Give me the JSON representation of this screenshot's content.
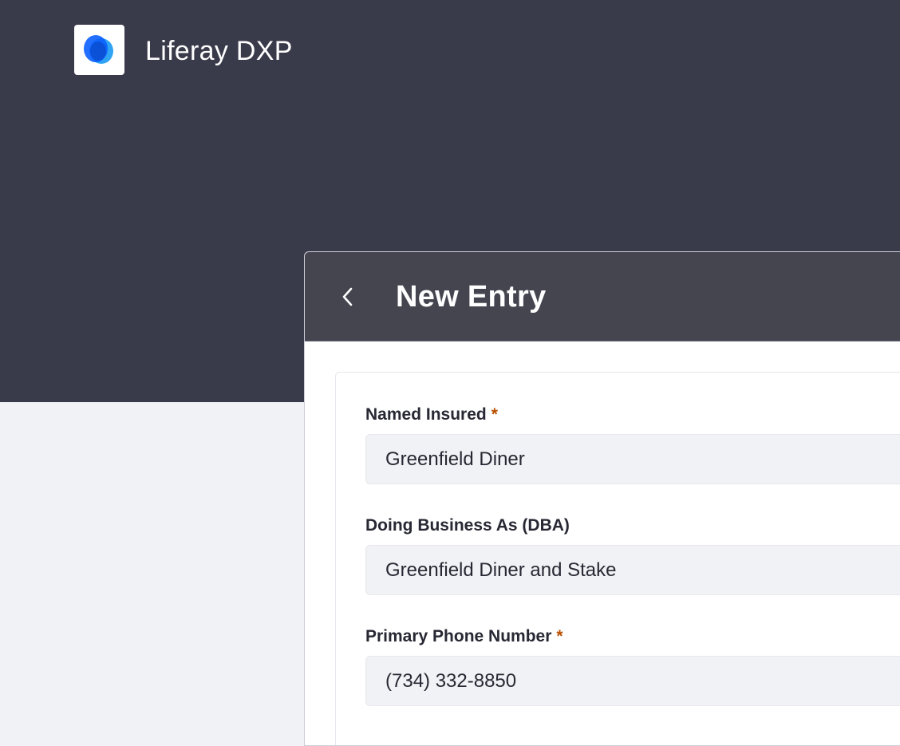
{
  "app": {
    "title": "Liferay DXP"
  },
  "panel": {
    "title": "New Entry"
  },
  "form": {
    "fields": [
      {
        "label": "Named Insured",
        "required": true,
        "value": "Greenfield Diner"
      },
      {
        "label": "Doing Business As (DBA)",
        "required": false,
        "value": "Greenfield Diner and Stake"
      },
      {
        "label": "Primary Phone Number",
        "required": true,
        "value": "(734) 332-8850"
      }
    ],
    "required_marker": "*"
  },
  "colors": {
    "header_bg": "#393a4a",
    "panel_header_bg": "#44454f",
    "page_bg": "#f1f2f5",
    "input_bg": "#f1f2f5",
    "required": "#b95000",
    "logo_blue_dark": "#0b5fff",
    "logo_blue_light": "#2fa4f5"
  },
  "icons": {
    "logo": "liferay-logo-icon",
    "back": "chevron-left-icon"
  }
}
